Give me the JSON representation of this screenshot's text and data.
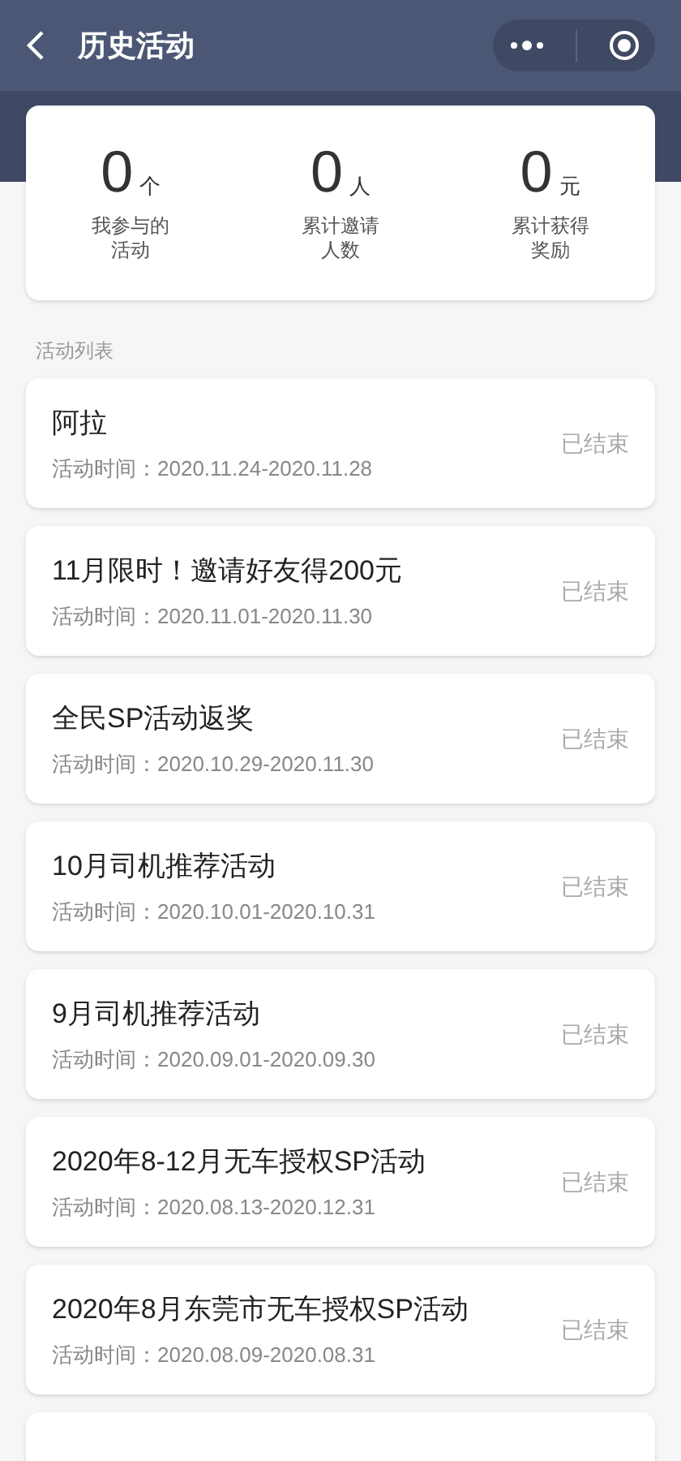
{
  "header": {
    "title": "历史活动"
  },
  "stats": [
    {
      "value": "0",
      "unit": "个",
      "label": "我参与的活动"
    },
    {
      "value": "0",
      "unit": "人",
      "label": "累计邀请人数"
    },
    {
      "value": "0",
      "unit": "元",
      "label": "累计获得奖励"
    }
  ],
  "section_title": "活动列表",
  "activities": [
    {
      "name": "阿拉",
      "time": "活动时间：2020.11.24-2020.11.28",
      "status": "已结束"
    },
    {
      "name": "11月限时！邀请好友得200元",
      "time": "活动时间：2020.11.01-2020.11.30",
      "status": "已结束"
    },
    {
      "name": "全民SP活动返奖",
      "time": "活动时间：2020.10.29-2020.11.30",
      "status": "已结束"
    },
    {
      "name": "10月司机推荐活动",
      "time": "活动时间：2020.10.01-2020.10.31",
      "status": "已结束"
    },
    {
      "name": "9月司机推荐活动",
      "time": "活动时间：2020.09.01-2020.09.30",
      "status": "已结束"
    },
    {
      "name": "2020年8-12月无车授权SP活动",
      "time": "活动时间：2020.08.13-2020.12.31",
      "status": "已结束"
    },
    {
      "name": "2020年8月东莞市无车授权SP活动",
      "time": "活动时间：2020.08.09-2020.08.31",
      "status": "已结束"
    }
  ]
}
